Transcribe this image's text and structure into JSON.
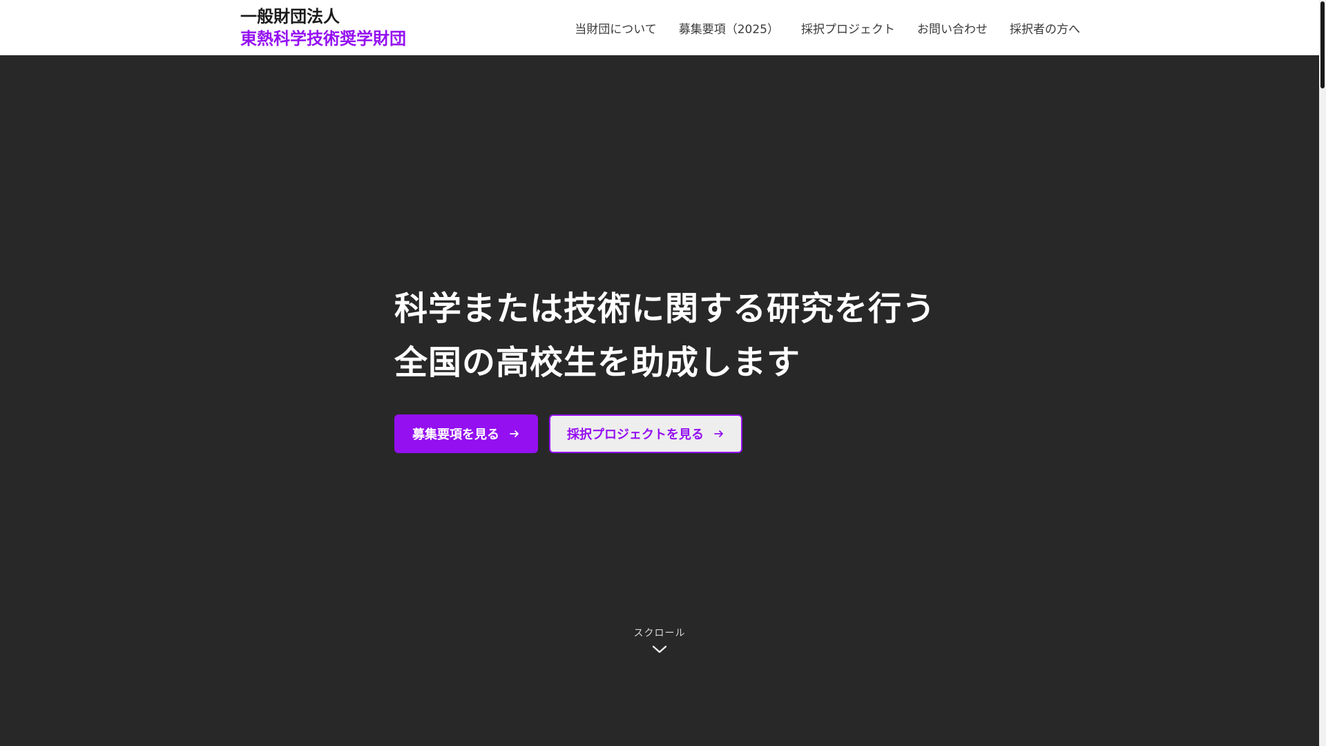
{
  "site": {
    "brand_line1": "一般財団法人",
    "brand_line2": "東熱科学技術奨学財団"
  },
  "nav": {
    "items": [
      {
        "label": "当財団について"
      },
      {
        "label": "募集要項（2025）"
      },
      {
        "label": "採択プロジェクト"
      },
      {
        "label": "お問い合わせ"
      },
      {
        "label": "採択者の方へ"
      }
    ]
  },
  "hero": {
    "headline_line1": "科学または技術に関する研究を行う",
    "headline_line2": "全国の高校生を助成します",
    "primary_button": "募集要項を見る",
    "secondary_button": "採択プロジェクトを見る",
    "scroll_label": "スクロール"
  },
  "colors": {
    "accent": "#9410f0",
    "hero_background": "#282828",
    "header_background": "#ffffff"
  },
  "icons": {
    "button_arrow": "arrow-right-icon",
    "scroll": "chevron-down-icon"
  }
}
